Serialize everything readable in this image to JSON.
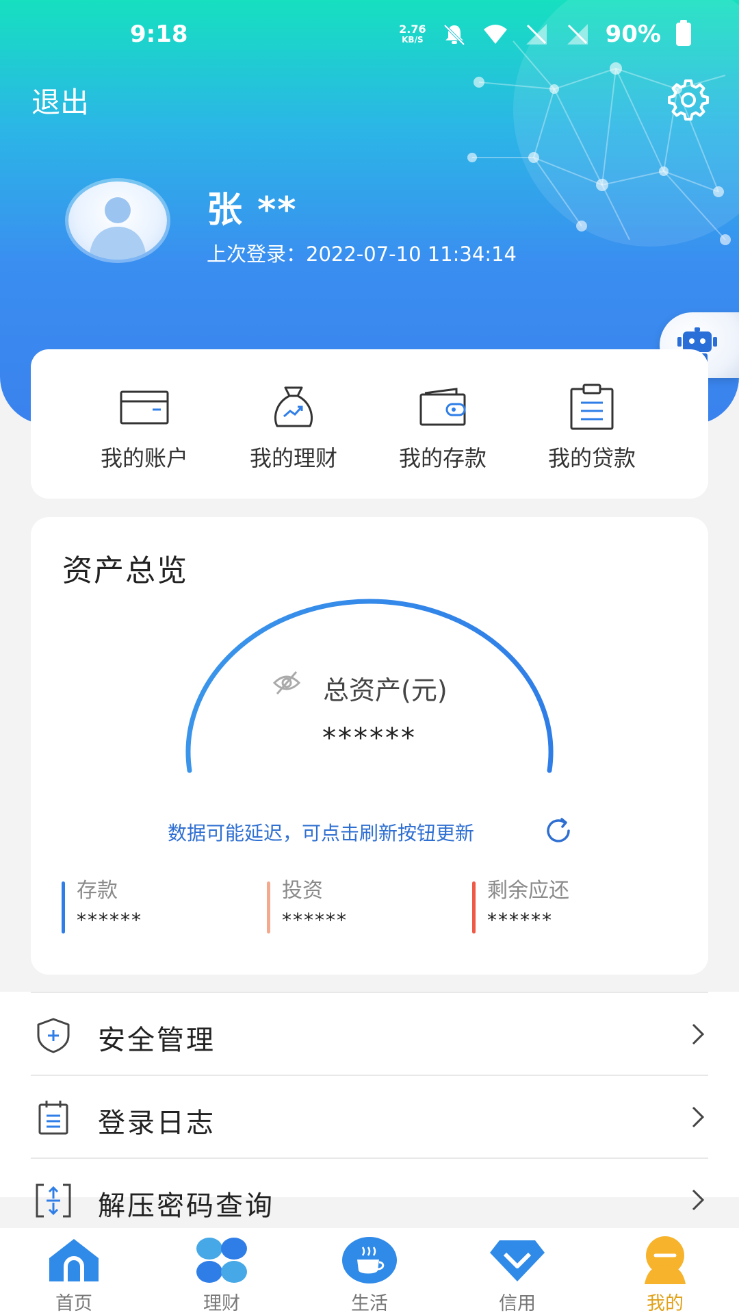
{
  "status_bar": {
    "time": "9:18",
    "net_speed_value": "2.76",
    "net_speed_unit": "KB/S",
    "battery": "90%"
  },
  "header": {
    "logout_label": "退出",
    "user_name": "张 **",
    "last_login": "上次登录：2022-07-10 11:34:14"
  },
  "quick_actions": [
    {
      "label": "我的账户",
      "icon": "card-icon"
    },
    {
      "label": "我的理财",
      "icon": "money-bag-icon"
    },
    {
      "label": "我的存款",
      "icon": "wallet-icon"
    },
    {
      "label": "我的贷款",
      "icon": "clipboard-icon"
    }
  ],
  "asset_overview": {
    "title": "资产总览",
    "total_label": "总资产(元)",
    "total_value": "******",
    "delay_note": "数据可能延迟，可点击刷新按钮更新",
    "stats": [
      {
        "label": "存款",
        "value": "******",
        "color": "#2f7ee8"
      },
      {
        "label": "投资",
        "value": "******",
        "color": "#f5a98c"
      },
      {
        "label": "剩余应还",
        "value": "******",
        "color": "#ee5a45"
      }
    ]
  },
  "menu": [
    {
      "label": "安全管理",
      "icon": "shield-icon"
    },
    {
      "label": "登录日志",
      "icon": "log-icon"
    },
    {
      "label": "解压密码查询",
      "icon": "unzip-icon"
    }
  ],
  "tabs": [
    {
      "label": "首页",
      "icon": "home-icon"
    },
    {
      "label": "理财",
      "icon": "clover-icon"
    },
    {
      "label": "生活",
      "icon": "coffee-icon"
    },
    {
      "label": "信用",
      "icon": "diamond-icon"
    },
    {
      "label": "我的",
      "icon": "profile-icon",
      "active": true
    }
  ],
  "colors": {
    "accent_blue": "#3a82ee",
    "active_tab": "#e0a21a",
    "gauge_blue": "#2f8ae8"
  }
}
